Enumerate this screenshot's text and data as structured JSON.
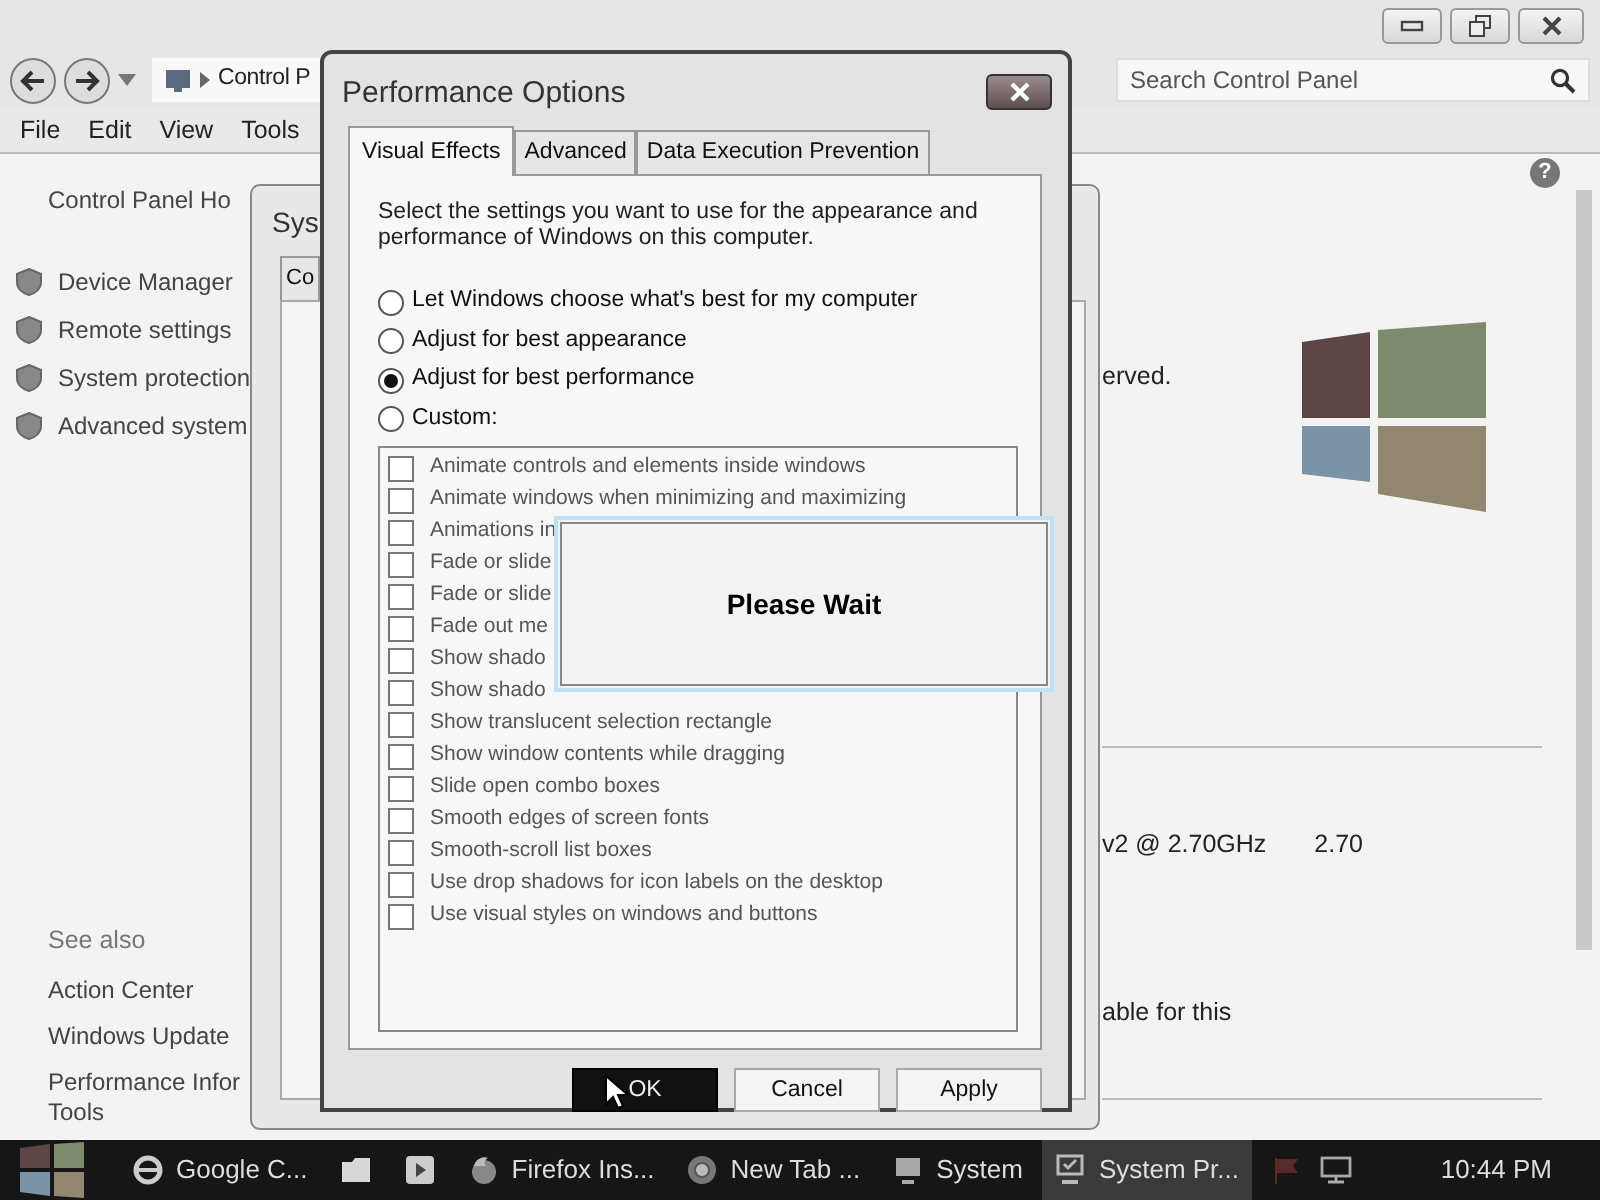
{
  "control_panel": {
    "breadcrumb": "Control P",
    "search_placeholder": "Search Control Panel",
    "menu": [
      "File",
      "Edit",
      "View",
      "Tools"
    ],
    "sidebar": {
      "home": "Control Panel Ho",
      "tasks": [
        "Device Manager",
        "Remote settings",
        "System protection",
        "Advanced system"
      ],
      "see_also_heading": "See also",
      "see_also": [
        {
          "lines": [
            "Action Center"
          ]
        },
        {
          "lines": [
            "Windows Update"
          ]
        },
        {
          "lines": [
            "Performance Infor",
            "Tools"
          ]
        }
      ]
    },
    "help": "?",
    "content": {
      "copyright": "erved.",
      "processor": "v2 @ 2.70GHz",
      "processor_speed": "2.70",
      "pen_touch": "able for this"
    }
  },
  "system_properties": {
    "title": "Sys",
    "tabs": [
      {
        "label": "Co",
        "selected": false
      }
    ]
  },
  "performance_options": {
    "title": "Performance Options",
    "tabs": [
      {
        "label": "Visual Effects",
        "selected": true
      },
      {
        "label": "Advanced",
        "selected": false
      },
      {
        "label": "Data Execution Prevention",
        "selected": false
      }
    ],
    "intro": "Select the settings you want to use for the appearance and performance of Windows on this computer.",
    "options": [
      {
        "label": "Let Windows choose what's best for my computer",
        "selected": false
      },
      {
        "label": "Adjust for best appearance",
        "selected": false
      },
      {
        "label": "Adjust for best performance",
        "selected": true
      },
      {
        "label": "Custom:",
        "selected": false
      }
    ],
    "effects": [
      {
        "label": "Animate controls and elements inside windows",
        "checked": false
      },
      {
        "label": "Animate windows when minimizing and maximizing",
        "checked": false
      },
      {
        "label": "Animations in",
        "checked": false
      },
      {
        "label": "Fade or slide",
        "checked": false
      },
      {
        "label": "Fade or slide",
        "checked": false
      },
      {
        "label": "Fade out me",
        "checked": false
      },
      {
        "label": "Show shado",
        "checked": false
      },
      {
        "label": "Show shado",
        "checked": false
      },
      {
        "label": "Show translucent selection rectangle",
        "checked": false
      },
      {
        "label": "Show window contents while dragging",
        "checked": false
      },
      {
        "label": "Slide open combo boxes",
        "checked": false
      },
      {
        "label": "Smooth edges of screen fonts",
        "checked": false
      },
      {
        "label": "Smooth-scroll list boxes",
        "checked": false
      },
      {
        "label": "Use drop shadows for icon labels on the desktop",
        "checked": false
      },
      {
        "label": "Use visual styles on windows and buttons",
        "checked": false
      }
    ],
    "buttons": [
      {
        "label": "OK",
        "pressed": true
      },
      {
        "label": "Cancel",
        "pressed": false
      },
      {
        "label": "Apply",
        "pressed": false
      }
    ]
  },
  "please_wait": {
    "message": "Please Wait"
  },
  "taskbar": {
    "items": [
      {
        "kind": "ie",
        "label": "Google C...",
        "active": false
      },
      {
        "kind": "folder",
        "active": false
      },
      {
        "kind": "media",
        "active": false
      },
      {
        "kind": "firefox",
        "label": "Firefox Ins...",
        "active": false
      },
      {
        "kind": "chrome",
        "label": "New Tab ...",
        "active": false
      },
      {
        "kind": "system",
        "label": "System",
        "active": false
      },
      {
        "kind": "sysprops",
        "label": "System Pr...",
        "active": true
      }
    ],
    "clock": "10:44 PM"
  }
}
